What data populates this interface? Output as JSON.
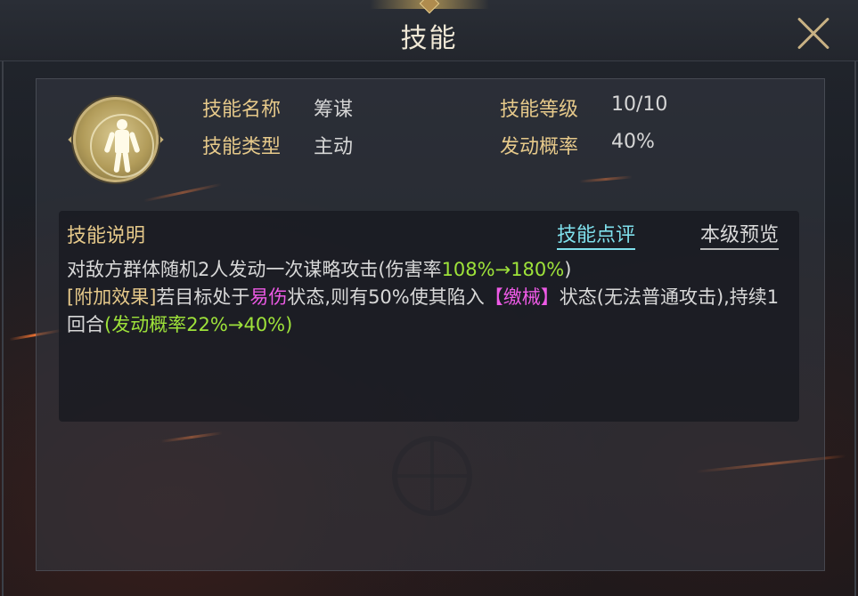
{
  "header": {
    "title": "技能"
  },
  "skill": {
    "name_label": "技能名称",
    "name_value": "筹谋",
    "type_label": "技能类型",
    "type_value": "主动",
    "level_label": "技能等级",
    "level_value": "10/10",
    "prob_label": "发动概率",
    "prob_value": "40%"
  },
  "description": {
    "title": "技能说明",
    "review_link": "技能点评",
    "preview_link": "本级预览",
    "line1_prefix": "对敌方群体随机2人发动一次谋略攻击(伤害率",
    "line1_value": "108%→180%",
    "line1_suffix": ")",
    "extra_tag": "[附加效果]",
    "extra_text1": "若目标处于",
    "status_vulnerable": "易伤",
    "extra_text2": "状态,则有50%使其陷入",
    "status_disarm": "【缴械】",
    "extra_text3": "状态(无法普通攻击),持续1回合",
    "prob_change": "(发动概率22%→40%)"
  },
  "colors": {
    "label_gold": "#e6c98a",
    "value_green": "#9ee23a",
    "status_pink": "#ee5ae6",
    "link_cyan": "#7fe0ec"
  },
  "icons": {
    "skill_icon": "warrior-figure-icon",
    "close": "close-icon"
  }
}
